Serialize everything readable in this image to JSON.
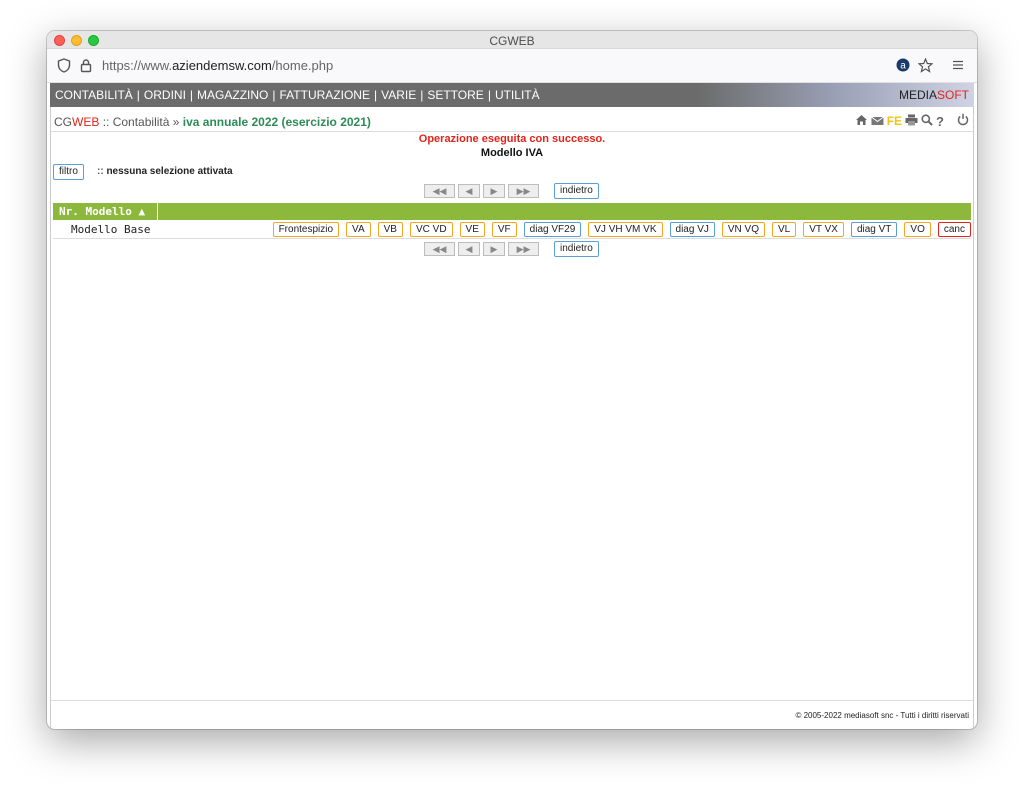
{
  "window": {
    "title": "CGWEB"
  },
  "browser": {
    "url_prefix": "https://www.",
    "url_domain": "aziendemsw.com",
    "url_path": "/home.php"
  },
  "menu": {
    "items": [
      "CONTABILITÀ",
      "ORDINI",
      "MAGAZZINO",
      "FATTURAZIONE",
      "VARIE",
      "SETTORE",
      "UTILITÀ"
    ],
    "brand_a": "MEDIA",
    "brand_b": "SOFT"
  },
  "breadcrumb": {
    "cg": "CG",
    "web": "WEB",
    "sep1": "::",
    "section": "Contabilità",
    "sep2": "»",
    "current": "iva annuale 2022 (esercizio 2021)"
  },
  "tools": {
    "fe": "FE",
    "help": "?"
  },
  "messages": {
    "success": "Operazione eseguita con successo.",
    "title": "Modello IVA"
  },
  "filter": {
    "button": "filtro",
    "prefix": "::",
    "status": "nessuna selezione attivata"
  },
  "pager": {
    "first": "◀◀",
    "prev": "◀",
    "next": "▶",
    "last": "▶▶",
    "back": "indietro"
  },
  "table": {
    "header": "Nr. Modello ▲",
    "rows": [
      {
        "label": "Modello Base"
      }
    ],
    "actions": [
      "Frontespizio",
      "VA",
      "VB",
      "VC VD",
      "VE",
      "VF",
      "diag VF29",
      "VJ VH VM VK",
      "diag VJ",
      "VN VQ",
      "VL",
      "VT VX",
      "diag VT",
      "VO",
      "canc"
    ]
  },
  "footer": "© 2005-2022 mediasoft snc - Tutti i diritti riservati",
  "colors": {
    "header_green": "#8cb83c",
    "success_red": "#e1251b",
    "current_green": "#2e8b57",
    "action_orange": "#f5a623",
    "action_blue": "#5a9fd6"
  }
}
